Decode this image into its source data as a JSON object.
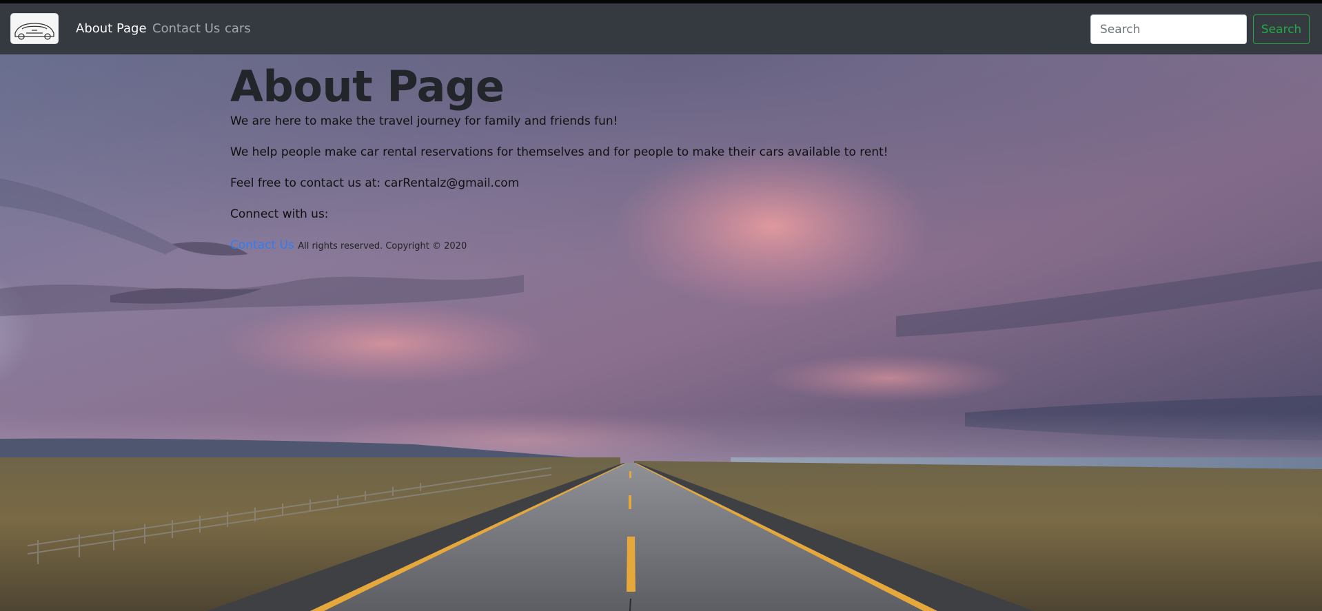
{
  "nav": {
    "brand_icon": "car-logo-icon",
    "links": [
      {
        "label": "About Page",
        "active": true
      },
      {
        "label": "Contact Us",
        "active": false
      },
      {
        "label": "cars",
        "active": false
      }
    ],
    "search_placeholder": "Search",
    "search_button": "Search"
  },
  "main": {
    "title": "About Page",
    "paragraphs": [
      "We are here to make the travel journey for family and friends fun!",
      "We help people make car rental reservations for themselves and for people to make their cars available to rent!",
      "Feel free to contact us at: carRentalz@gmail.com",
      "Connect with us:"
    ],
    "footer_link": "Contact Us",
    "footer_note": "All rights reserved. Copyright © 2020"
  },
  "colors": {
    "navbar": "#343a40",
    "link_active": "#ffffff",
    "link_inactive": "#9a9da0",
    "search_button": "#28a745",
    "footer_link": "#2f7df6"
  }
}
